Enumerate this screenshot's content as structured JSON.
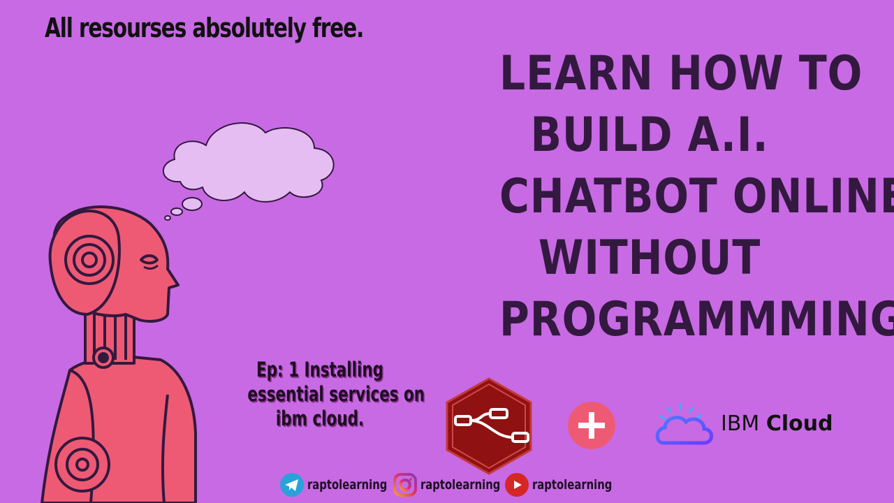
{
  "tagline": "All resourses absolutely free.",
  "headline": {
    "lines": [
      "Learn how to",
      "build A.I.",
      "chatbot online",
      "without",
      "programmming!"
    ]
  },
  "episode": {
    "lines": [
      "Ep: 1 Installing",
      "essential services on",
      "ibm cloud."
    ]
  },
  "logos": {
    "plus_icon": "plus-icon",
    "ibm_brand": "IBM",
    "ibm_product": "Cloud"
  },
  "social": [
    {
      "icon": "telegram-icon",
      "handle": "raptolearning"
    },
    {
      "icon": "instagram-icon",
      "handle": "raptolearning"
    },
    {
      "icon": "youtube-icon",
      "handle": "raptolearning"
    }
  ],
  "colors": {
    "background": "#c86ae4",
    "headline": "#33193f",
    "robot": "#ee5a74",
    "node_red": "#8f1111",
    "plus": "#ee5a74"
  }
}
